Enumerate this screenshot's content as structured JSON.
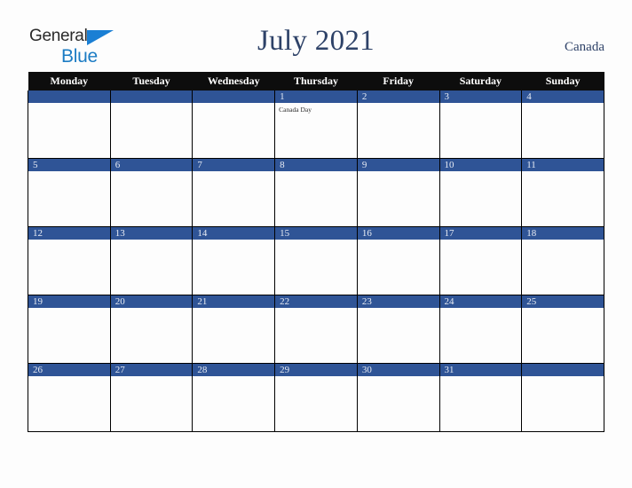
{
  "brand": {
    "name_part1": "General",
    "name_part2": "Blue",
    "triangle_color": "#1a7fd4",
    "blue_text_color": "#1c7cc4"
  },
  "header": {
    "title": "July 2021",
    "country": "Canada",
    "title_color": "#2e4268"
  },
  "colors": {
    "weekday_header_bg": "#0d0d0d",
    "date_bar_bg": "#2f5496",
    "cell_bg": "#fdfdfd",
    "page_bg": "#fdfdfd",
    "grid_line": "#000000"
  },
  "weekdays": [
    "Monday",
    "Tuesday",
    "Wednesday",
    "Thursday",
    "Friday",
    "Saturday",
    "Sunday"
  ],
  "weeks": [
    [
      {
        "date": "",
        "events": []
      },
      {
        "date": "",
        "events": []
      },
      {
        "date": "",
        "events": []
      },
      {
        "date": "1",
        "events": [
          "Canada Day"
        ]
      },
      {
        "date": "2",
        "events": []
      },
      {
        "date": "3",
        "events": []
      },
      {
        "date": "4",
        "events": []
      }
    ],
    [
      {
        "date": "5",
        "events": []
      },
      {
        "date": "6",
        "events": []
      },
      {
        "date": "7",
        "events": []
      },
      {
        "date": "8",
        "events": []
      },
      {
        "date": "9",
        "events": []
      },
      {
        "date": "10",
        "events": []
      },
      {
        "date": "11",
        "events": []
      }
    ],
    [
      {
        "date": "12",
        "events": []
      },
      {
        "date": "13",
        "events": []
      },
      {
        "date": "14",
        "events": []
      },
      {
        "date": "15",
        "events": []
      },
      {
        "date": "16",
        "events": []
      },
      {
        "date": "17",
        "events": []
      },
      {
        "date": "18",
        "events": []
      }
    ],
    [
      {
        "date": "19",
        "events": []
      },
      {
        "date": "20",
        "events": []
      },
      {
        "date": "21",
        "events": []
      },
      {
        "date": "22",
        "events": []
      },
      {
        "date": "23",
        "events": []
      },
      {
        "date": "24",
        "events": []
      },
      {
        "date": "25",
        "events": []
      }
    ],
    [
      {
        "date": "26",
        "events": []
      },
      {
        "date": "27",
        "events": []
      },
      {
        "date": "28",
        "events": []
      },
      {
        "date": "29",
        "events": []
      },
      {
        "date": "30",
        "events": []
      },
      {
        "date": "31",
        "events": []
      },
      {
        "date": "",
        "events": []
      }
    ]
  ]
}
